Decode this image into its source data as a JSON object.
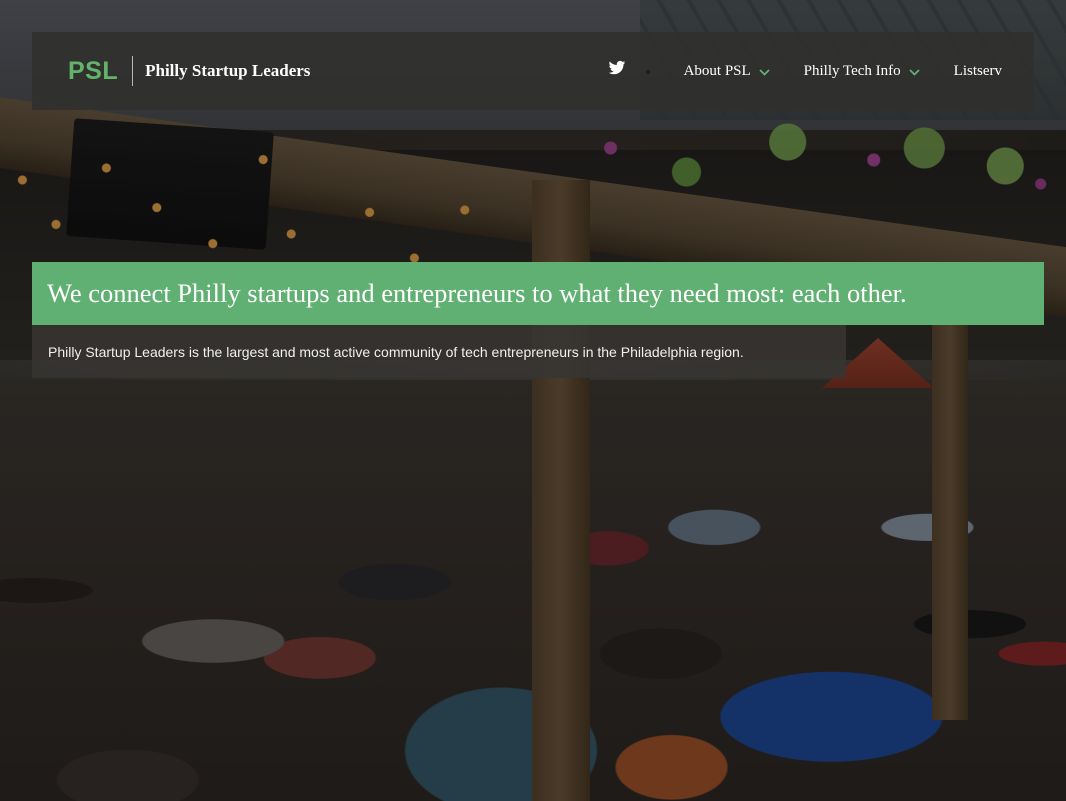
{
  "navbar": {
    "logo": "PSL",
    "site_name": "Philly Startup Leaders",
    "twitter_icon": "twitter-icon",
    "items": [
      {
        "label": "About PSL",
        "has_dropdown": true
      },
      {
        "label": "Philly Tech Info",
        "has_dropdown": true
      },
      {
        "label": "Listserv",
        "has_dropdown": false
      }
    ],
    "chevron_color": "#61b073"
  },
  "hero": {
    "headline": "We connect Philly startups and entrepreneurs to what they need most: each other.",
    "subtext": "Philly Startup Leaders is the largest and most active community of tech entrepreneurs in the Philadelphia region."
  },
  "colors": {
    "brand_green": "#61b073",
    "logo_green": "#63b36a",
    "nav_bg": "#30302e"
  }
}
